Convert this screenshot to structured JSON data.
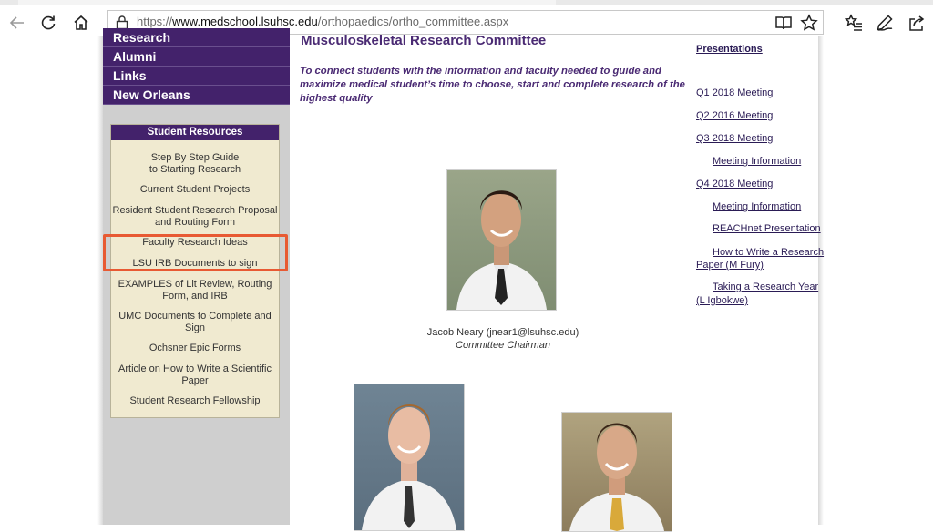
{
  "browser": {
    "url_prefix": "https://",
    "url_host": "www.medschool.lsuhsc.edu",
    "url_path": "/orthopaedics/ortho_committee.aspx",
    "icons": [
      "back-icon",
      "refresh-icon",
      "home-icon",
      "lock-icon",
      "reading-view-icon",
      "favorite-star-icon",
      "favorites-list-icon",
      "pen-icon",
      "share-icon"
    ]
  },
  "left_nav": {
    "items": [
      "Research",
      "Alumni",
      "Links",
      "New Orleans"
    ]
  },
  "student_resources": {
    "heading": "Student Resources",
    "links": [
      {
        "line1": "Step By Step Guide",
        "line2": "to Starting Research"
      },
      {
        "line1": "Current Student Projects",
        "line2": ""
      },
      {
        "line1": "Resident Student Research Proposal",
        "line2": "and Routing Form"
      },
      {
        "line1": "Faculty Research Ideas",
        "line2": ""
      },
      {
        "line1": "LSU IRB Documents to sign",
        "line2": ""
      },
      {
        "line1": "EXAMPLES of Lit Review, Routing",
        "line2": "Form, and  IRB"
      },
      {
        "line1": "UMC Documents to Complete and",
        "line2": "Sign"
      },
      {
        "line1": "Ochsner Epic Forms",
        "line2": ""
      },
      {
        "line1": "Article on How to Write a Scientific",
        "line2": "Paper"
      },
      {
        "line1": "Student Research Fellowship",
        "line2": ""
      }
    ]
  },
  "main": {
    "title": "Musculoskeletal Research Committee",
    "intro": "To connect students with the information and faculty needed to guide and maximize medical student’s time to choose, start and complete research of the highest quality",
    "chair_name": "Jacob Neary (jnear1@lsuhsc.edu)",
    "chair_role": "Committee Chairman"
  },
  "right_links": {
    "top": "Presentations",
    "items": [
      "Q1 2018 Meeting",
      "Q2 2016 Meeting",
      "Q3 2018 Meeting",
      "Meeting Information",
      "Q4 2018 Meeting",
      "Meeting Information",
      "REACHnet Presentation",
      "How to Write a Research",
      "Paper (M Fury)",
      "Taking a Research Year",
      "(L Igbokwe)"
    ]
  }
}
